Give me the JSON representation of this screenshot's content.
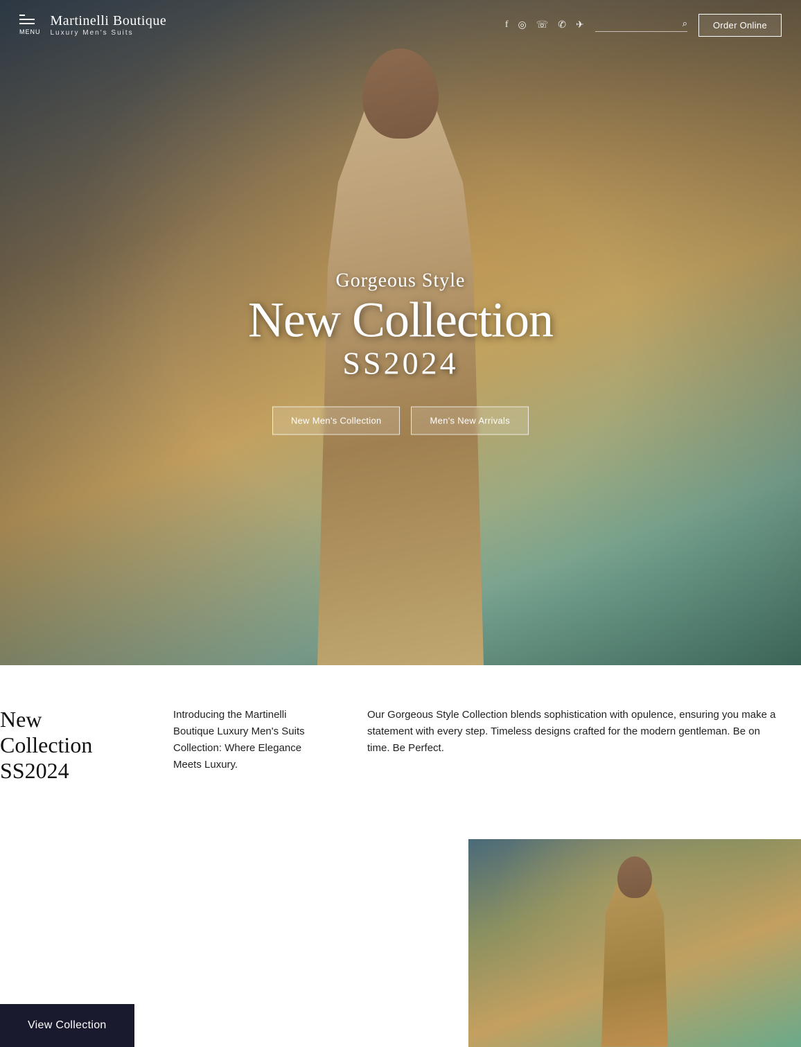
{
  "brand": {
    "name": "Martinelli Boutique",
    "tagline": "Luxury Men's Suits",
    "menu_label": "MENU"
  },
  "nav": {
    "social": [
      {
        "icon": "f",
        "name": "facebook",
        "label": "Facebook"
      },
      {
        "icon": "◉",
        "name": "instagram",
        "label": "Instagram"
      },
      {
        "icon": "☎",
        "name": "viber",
        "label": "Viber"
      },
      {
        "icon": "✆",
        "name": "whatsapp",
        "label": "WhatsApp"
      },
      {
        "icon": "✈",
        "name": "telegram",
        "label": "Telegram"
      }
    ],
    "search_placeholder": "",
    "order_button": "Order Online"
  },
  "hero": {
    "subtitle": "Gorgeous Style",
    "title": "New Collection",
    "year": "SS2024",
    "button1": "New Men's Collection",
    "button2": "Men's New Arrivals"
  },
  "info": {
    "heading1": "New Collection",
    "heading2": "SS2024",
    "body1": "Introducing the Martinelli Boutique Luxury Men's Suits Collection:  Where Elegance Meets Luxury.",
    "body2": "Our Gorgeous Style Collection blends sophistication with opulence, ensuring you make a statement with every step. Timeless designs crafted for the modern gentleman. Be on time. Be Perfect."
  },
  "view_collection": {
    "label": "View Collection"
  }
}
